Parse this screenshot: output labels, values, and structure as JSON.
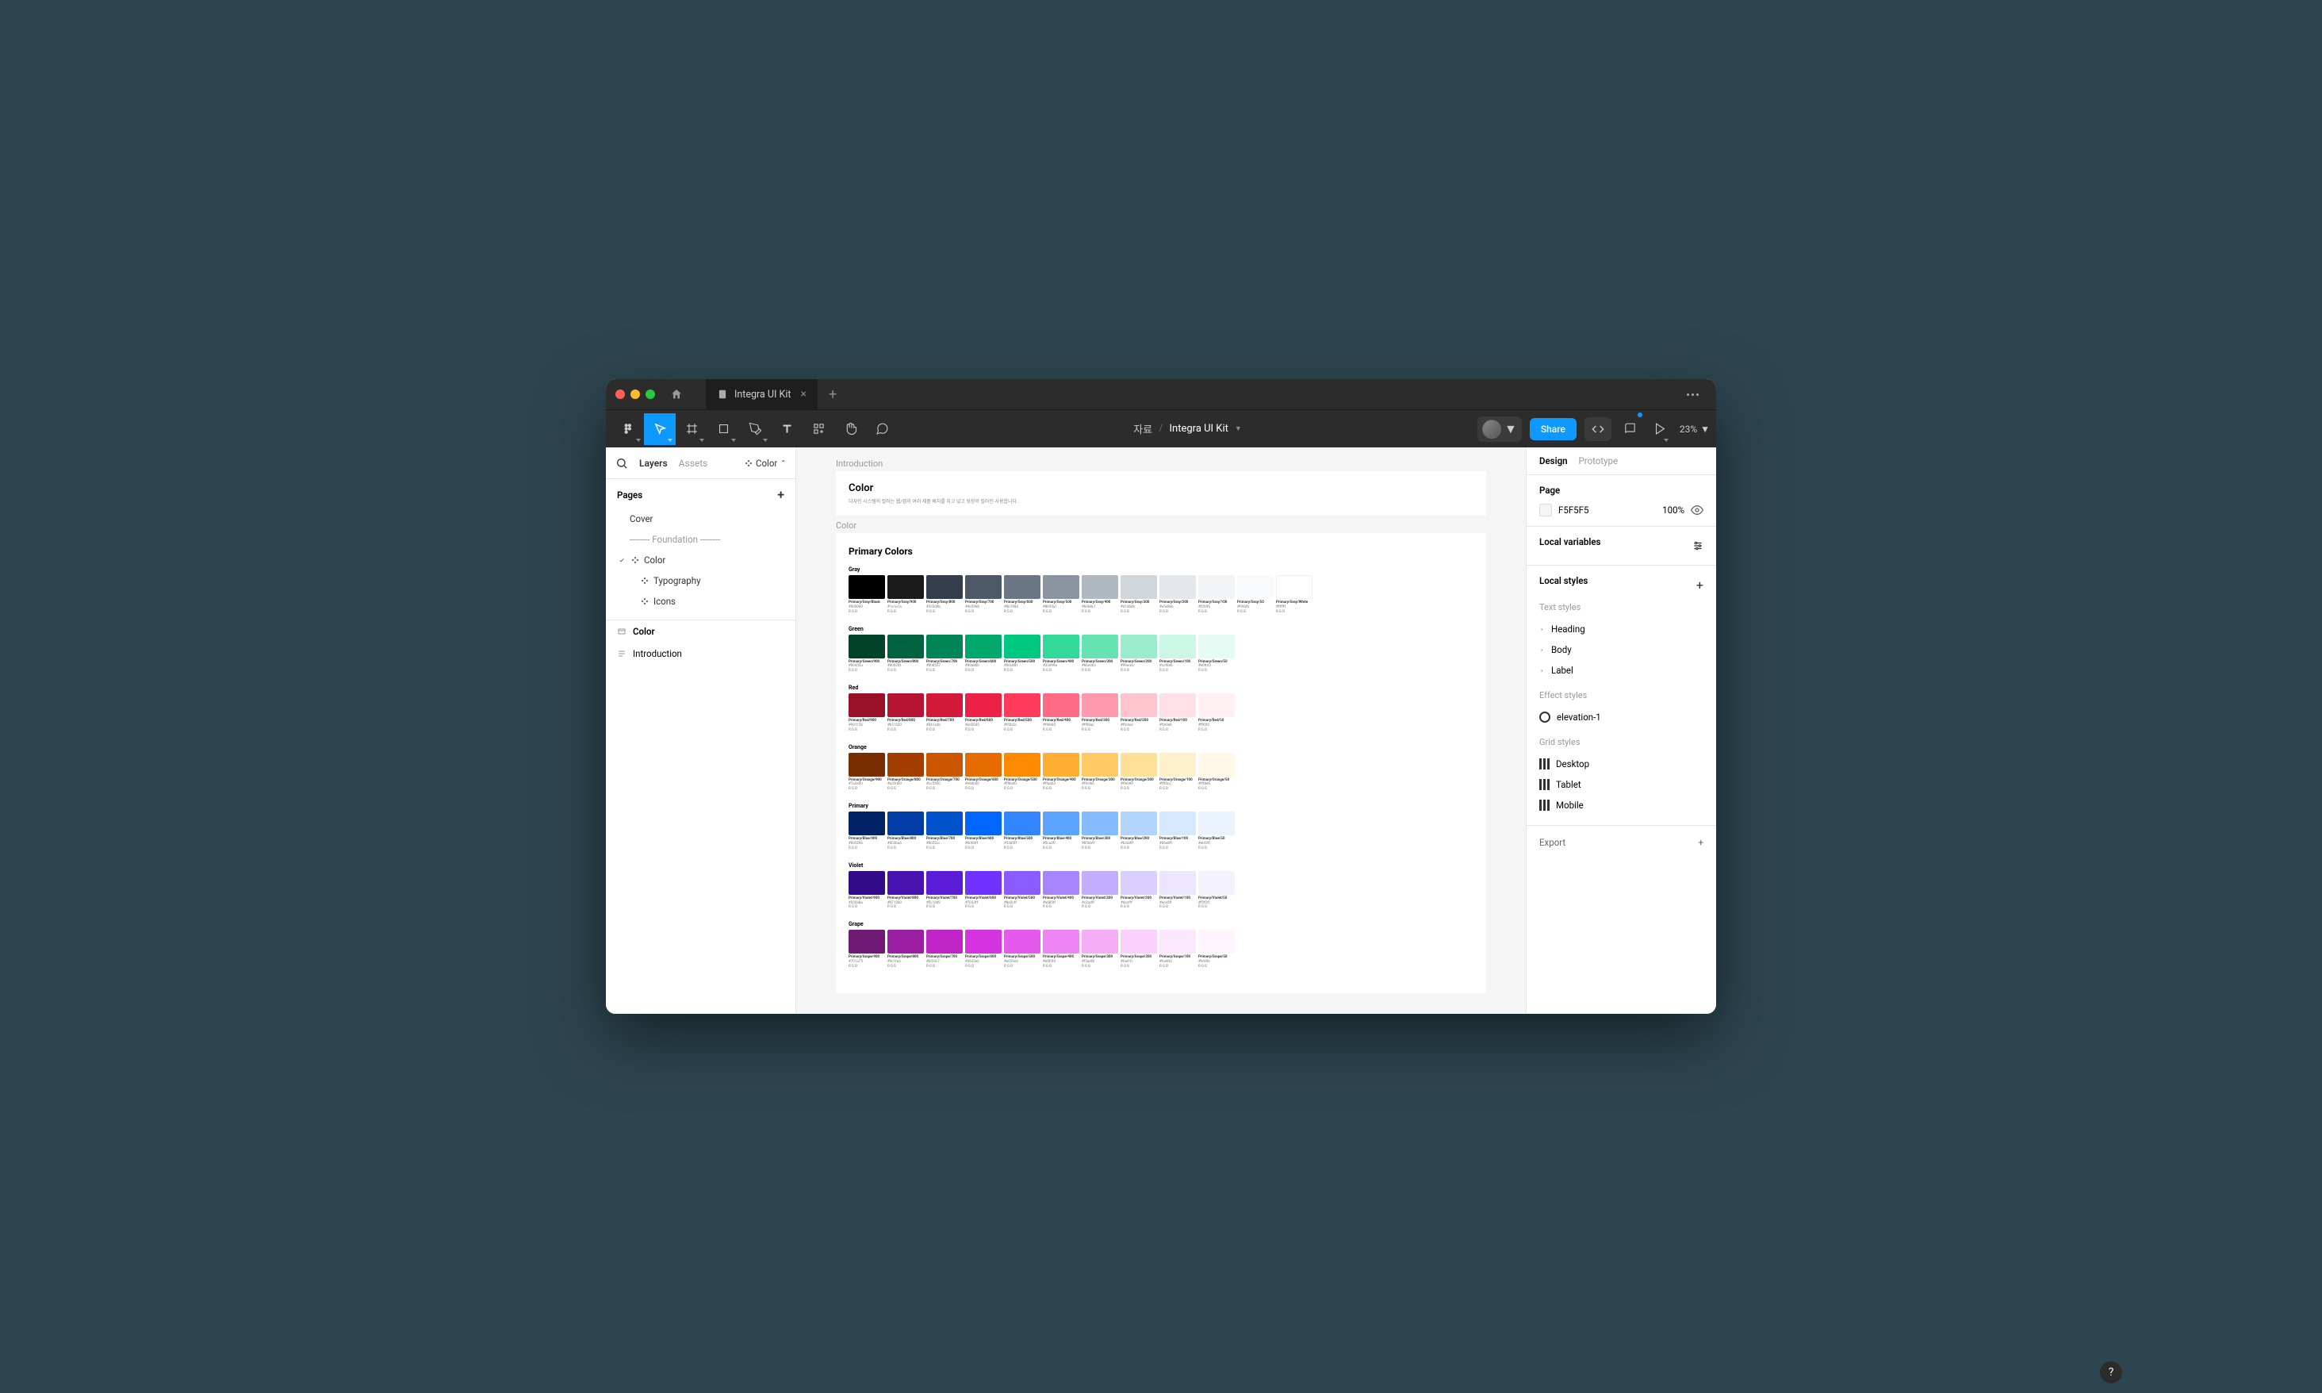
{
  "tab": {
    "title": "Integra UI Kit"
  },
  "breadcrumb": {
    "project": "자료",
    "file": "Integra UI Kit"
  },
  "toolbar": {
    "share": "Share",
    "zoom": "23%"
  },
  "leftPanel": {
    "tabs": {
      "layers": "Layers",
      "assets": "Assets",
      "page": "Color"
    },
    "pagesHeader": "Pages",
    "pages": {
      "cover": "Cover",
      "foundation": "-------- Foundation --------",
      "color": "Color",
      "typography": "Typography",
      "icons": "Icons"
    },
    "layers": {
      "color": "Color",
      "intro": "Introduction"
    }
  },
  "canvas": {
    "introLabel": "Introduction",
    "heading": "Color",
    "subtitle": "디자인 시스템의 컬러는 웹/앱의 여러 제품 배치를 지고 넣고 뒷장의 컬러인 사용합니다.",
    "sectionLabel": "Color",
    "paletteTitle": "Primary Colors",
    "rows": [
      {
        "label": "Gray",
        "swatches": [
          {
            "n": "Primary/Gray/Black",
            "h": "#000000",
            "c": "#000000"
          },
          {
            "n": "Primary/Gray/900",
            "h": "#1a1a1a",
            "c": "#1a1a1a"
          },
          {
            "n": "Primary/Gray/800",
            "h": "#333d4b",
            "c": "#333d4b"
          },
          {
            "n": "Primary/Gray/700",
            "h": "#4e5968",
            "c": "#4e5968"
          },
          {
            "n": "Primary/Gray/600",
            "h": "#6b7684",
            "c": "#6b7684"
          },
          {
            "n": "Primary/Gray/500",
            "h": "#8b95a1",
            "c": "#8b95a1"
          },
          {
            "n": "Primary/Gray/400",
            "h": "#b0b8c1",
            "c": "#b0b8c1"
          },
          {
            "n": "Primary/Gray/300",
            "h": "#d1d6db",
            "c": "#d1d6db"
          },
          {
            "n": "Primary/Gray/200",
            "h": "#e5e8eb",
            "c": "#e5e8eb"
          },
          {
            "n": "Primary/Gray/100",
            "h": "#f2f4f6",
            "c": "#f2f4f6"
          },
          {
            "n": "Primary/Gray/50",
            "h": "#f9fafb",
            "c": "#f9fafb"
          },
          {
            "n": "Primary/Gray/White",
            "h": "#ffffff",
            "c": "#ffffff"
          }
        ]
      },
      {
        "label": "Green",
        "swatches": [
          {
            "n": "Primary/Green/900",
            "h": "#00432a",
            "c": "#00432a"
          },
          {
            "n": "Primary/Green/800",
            "h": "#006241",
            "c": "#006241"
          },
          {
            "n": "Primary/Green/700",
            "h": "#008557",
            "c": "#008557"
          },
          {
            "n": "Primary/Green/600",
            "h": "#00a86b",
            "c": "#00a86b"
          },
          {
            "n": "Primary/Green/500",
            "h": "#00c881",
            "c": "#00c881"
          },
          {
            "n": "Primary/Green/400",
            "h": "#33d99a",
            "c": "#33d99a"
          },
          {
            "n": "Primary/Green/300",
            "h": "#66e3b3",
            "c": "#66e3b3"
          },
          {
            "n": "Primary/Green/200",
            "h": "#99edcc",
            "c": "#99edcc"
          },
          {
            "n": "Primary/Green/100",
            "h": "#ccf6e6",
            "c": "#ccf6e6"
          },
          {
            "n": "Primary/Green/50",
            "h": "#e6fbf3",
            "c": "#e6fbf3"
          }
        ]
      },
      {
        "label": "Red",
        "swatches": [
          {
            "n": "Primary/Red/900",
            "h": "#991126",
            "c": "#991126"
          },
          {
            "n": "Primary/Red/800",
            "h": "#b51530",
            "c": "#b51530"
          },
          {
            "n": "Primary/Red/700",
            "h": "#d41a3b",
            "c": "#d41a3b"
          },
          {
            "n": "Primary/Red/600",
            "h": "#ed2045",
            "c": "#ed2045"
          },
          {
            "n": "Primary/Red/500",
            "h": "#ff3b5c",
            "c": "#ff3b5c"
          },
          {
            "n": "Primary/Red/400",
            "h": "#ff6b85",
            "c": "#ff6b85"
          },
          {
            "n": "Primary/Red/300",
            "h": "#ff99ac",
            "c": "#ff99ac"
          },
          {
            "n": "Primary/Red/200",
            "h": "#ffc4ce",
            "c": "#ffc4ce"
          },
          {
            "n": "Primary/Red/100",
            "h": "#ffe0e6",
            "c": "#ffe0e6"
          },
          {
            "n": "Primary/Red/50",
            "h": "#fff0f3",
            "c": "#fff0f3"
          }
        ]
      },
      {
        "label": "Orange",
        "swatches": [
          {
            "n": "Primary/Orange/900",
            "h": "#7a2e00",
            "c": "#7a2e00"
          },
          {
            "n": "Primary/Orange/800",
            "h": "#a33d00",
            "c": "#a33d00"
          },
          {
            "n": "Primary/Orange/700",
            "h": "#cc5500",
            "c": "#cc5500"
          },
          {
            "n": "Primary/Orange/600",
            "h": "#e66b00",
            "c": "#e66b00"
          },
          {
            "n": "Primary/Orange/500",
            "h": "#ff8a00",
            "c": "#ff8a00"
          },
          {
            "n": "Primary/Orange/400",
            "h": "#ffad33",
            "c": "#ffad33"
          },
          {
            "n": "Primary/Orange/300",
            "h": "#ffc966",
            "c": "#ffc966"
          },
          {
            "n": "Primary/Orange/200",
            "h": "#ffe099",
            "c": "#ffe099"
          },
          {
            "n": "Primary/Orange/100",
            "h": "#fff0cc",
            "c": "#fff0cc"
          },
          {
            "n": "Primary/Orange/50",
            "h": "#fff8e6",
            "c": "#fff8e6"
          }
        ]
      },
      {
        "label": "Primary",
        "swatches": [
          {
            "n": "Primary/Blue/900",
            "h": "#002266",
            "c": "#002266"
          },
          {
            "n": "Primary/Blue/800",
            "h": "#003ba6",
            "c": "#003ba6"
          },
          {
            "n": "Primary/Blue/700",
            "h": "#0052cc",
            "c": "#0052cc"
          },
          {
            "n": "Primary/Blue/600",
            "h": "#0066ff",
            "c": "#0066ff"
          },
          {
            "n": "Primary/Blue/500",
            "h": "#3385ff",
            "c": "#3385ff"
          },
          {
            "n": "Primary/Blue/400",
            "h": "#5ca3ff",
            "c": "#5ca3ff"
          },
          {
            "n": "Primary/Blue/300",
            "h": "#85bbff",
            "c": "#85bbff"
          },
          {
            "n": "Primary/Blue/200",
            "h": "#b3d4ff",
            "c": "#b3d4ff"
          },
          {
            "n": "Primary/Blue/100",
            "h": "#d6e8ff",
            "c": "#d6e8ff"
          },
          {
            "n": "Primary/Blue/50",
            "h": "#ebf3ff",
            "c": "#ebf3ff"
          }
        ]
      },
      {
        "label": "Violet",
        "swatches": [
          {
            "n": "Primary/Violet/900",
            "h": "#330a8a",
            "c": "#330a8a"
          },
          {
            "n": "Primary/Violet/800",
            "h": "#4712b0",
            "c": "#4712b0"
          },
          {
            "n": "Primary/Violet/700",
            "h": "#5c1dd9",
            "c": "#5c1dd9"
          },
          {
            "n": "Primary/Violet/600",
            "h": "#7033ff",
            "c": "#7033ff"
          },
          {
            "n": "Primary/Violet/500",
            "h": "#8a5cff",
            "c": "#8a5cff"
          },
          {
            "n": "Primary/Violet/400",
            "h": "#a685ff",
            "c": "#a685ff"
          },
          {
            "n": "Primary/Violet/300",
            "h": "#c2adff",
            "c": "#c2adff"
          },
          {
            "n": "Primary/Violet/200",
            "h": "#dacfff",
            "c": "#dacfff"
          },
          {
            "n": "Primary/Violet/100",
            "h": "#ece5ff",
            "c": "#ece5ff"
          },
          {
            "n": "Primary/Violet/50",
            "h": "#f5f2ff",
            "c": "#f5f2ff"
          }
        ]
      },
      {
        "label": "Grape",
        "swatches": [
          {
            "n": "Primary/Grape/900",
            "h": "#701a75",
            "c": "#701a75"
          },
          {
            "n": "Primary/Grape/800",
            "h": "#9c1fa3",
            "c": "#9c1fa3"
          },
          {
            "n": "Primary/Grape/700",
            "h": "#bf24c7",
            "c": "#bf24c7"
          },
          {
            "n": "Primary/Grape/600",
            "h": "#d633e0",
            "c": "#d633e0"
          },
          {
            "n": "Primary/Grape/500",
            "h": "#e659ed",
            "c": "#e659ed"
          },
          {
            "n": "Primary/Grape/400",
            "h": "#ef85f4",
            "c": "#ef85f4"
          },
          {
            "n": "Primary/Grape/300",
            "h": "#f5adf8",
            "c": "#f5adf8"
          },
          {
            "n": "Primary/Grape/200",
            "h": "#fad1fc",
            "c": "#fad1fc"
          },
          {
            "n": "Primary/Grape/100",
            "h": "#fce8fd",
            "c": "#fce8fd"
          },
          {
            "n": "Primary/Grape/50",
            "h": "#fef4fe",
            "c": "#fef4fe"
          }
        ]
      }
    ]
  },
  "rightPanel": {
    "tabs": {
      "design": "Design",
      "prototype": "Prototype"
    },
    "page": {
      "label": "Page",
      "hex": "F5F5F5",
      "opacity": "100%"
    },
    "localVars": "Local variables",
    "localStyles": "Local styles",
    "textStyles": {
      "label": "Text styles",
      "items": [
        "Heading",
        "Body",
        "Label"
      ]
    },
    "effectStyles": {
      "label": "Effect styles",
      "items": [
        "elevation-1"
      ]
    },
    "gridStyles": {
      "label": "Grid styles",
      "items": [
        "Desktop",
        "Tablet",
        "Mobile"
      ]
    },
    "export": "Export"
  }
}
